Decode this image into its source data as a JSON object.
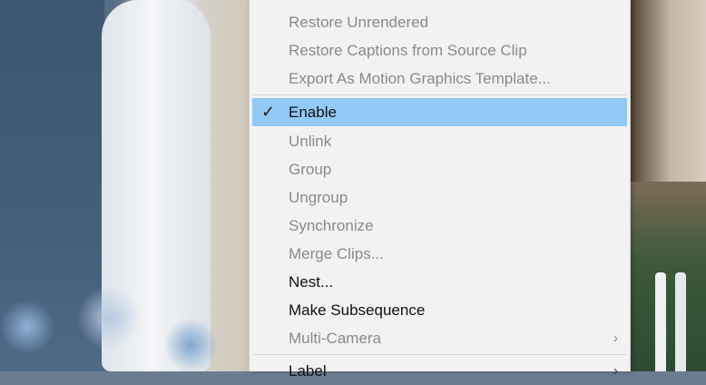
{
  "menu": {
    "items": [
      {
        "label": "Restore Unrendered",
        "enabled": false
      },
      {
        "label": "Restore Captions from Source Clip",
        "enabled": false
      },
      {
        "label": "Export As Motion Graphics Template...",
        "enabled": false
      },
      {
        "label": "Enable",
        "enabled": true,
        "checked": true,
        "highlighted": true
      },
      {
        "label": "Unlink",
        "enabled": false
      },
      {
        "label": "Group",
        "enabled": false
      },
      {
        "label": "Ungroup",
        "enabled": false
      },
      {
        "label": "Synchronize",
        "enabled": false
      },
      {
        "label": "Merge Clips...",
        "enabled": false
      },
      {
        "label": "Nest...",
        "enabled": true
      },
      {
        "label": "Make Subsequence",
        "enabled": true
      },
      {
        "label": "Multi-Camera",
        "enabled": false,
        "submenu": true
      },
      {
        "label": "Label",
        "enabled": true,
        "submenu": true
      }
    ],
    "check_glyph": "✓",
    "submenu_glyph": "›",
    "highlight_color": "#91c9f7"
  }
}
